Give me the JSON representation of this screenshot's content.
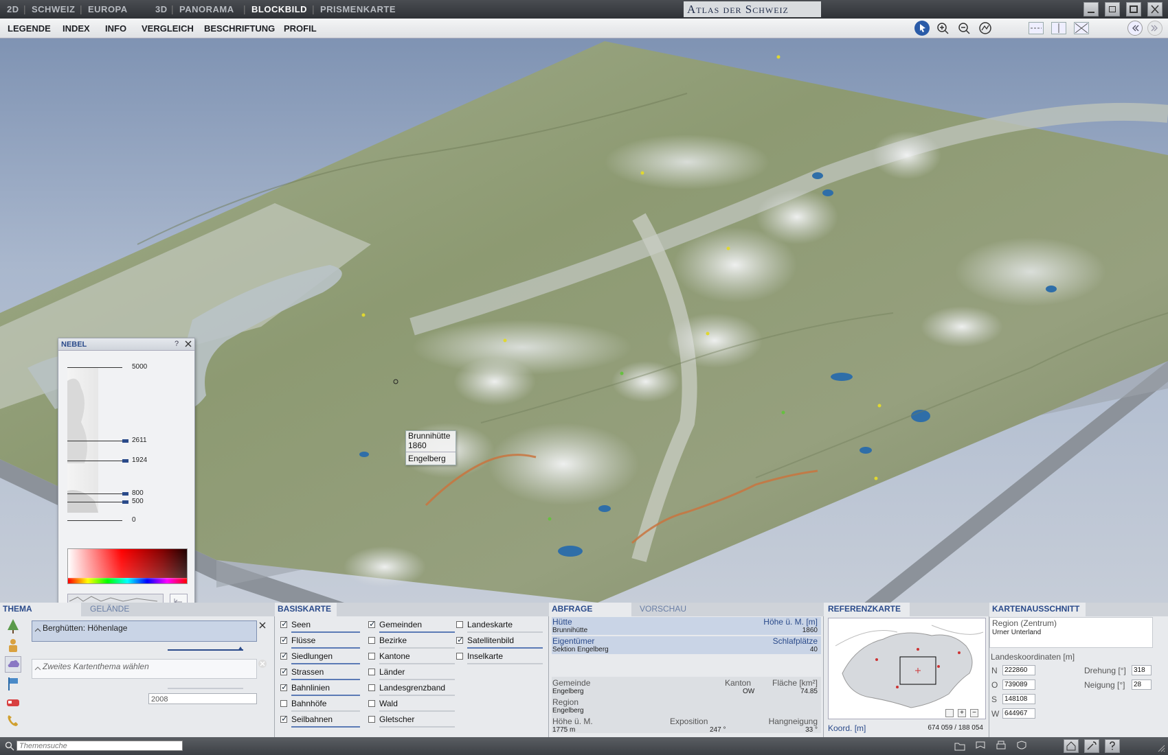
{
  "topbar": {
    "modes_2d": [
      "2D",
      "SCHWEIZ",
      "EUROPA"
    ],
    "modes_3d": [
      "3D",
      "PANORAMA",
      "BLOCKBILD",
      "PRISMENKARTE"
    ],
    "active": "BLOCKBILD",
    "app_title": "Atlas der Schweiz"
  },
  "menubar": {
    "items": [
      "LEGENDE",
      "INDEX",
      "INFO",
      "VERGLEICH",
      "BESCHRIFTUNG",
      "PROFIL"
    ]
  },
  "nebel": {
    "title": "NEBEL",
    "help": "?",
    "ticks": [
      "5000",
      "2611",
      "1924",
      "800",
      "500",
      "0"
    ]
  },
  "tooltip": {
    "name": "Brunnihütte",
    "height": "1860",
    "place": "Engelberg"
  },
  "thema": {
    "tab_active": "THEMA",
    "tab_inactive": "GELÄNDE",
    "theme1": "Berghütten: Höhenlage",
    "theme2_placeholder": "Zweites Kartenthema wählen",
    "year": "2008"
  },
  "basiskarte": {
    "title": "BASISKARTE",
    "col1": [
      {
        "label": "Seen",
        "checked": true
      },
      {
        "label": "Flüsse",
        "checked": true
      },
      {
        "label": "Siedlungen",
        "checked": true
      },
      {
        "label": "Strassen",
        "checked": true
      },
      {
        "label": "Bahnlinien",
        "checked": true
      },
      {
        "label": "Bahnhöfe",
        "checked": false
      },
      {
        "label": "Seilbahnen",
        "checked": true
      }
    ],
    "col2": [
      {
        "label": "Gemeinden",
        "checked": true
      },
      {
        "label": "Bezirke",
        "checked": false
      },
      {
        "label": "Kantone",
        "checked": false
      },
      {
        "label": "Länder",
        "checked": false
      },
      {
        "label": "Landesgrenzband",
        "checked": false
      },
      {
        "label": "Wald",
        "checked": false
      },
      {
        "label": "Gletscher",
        "checked": false
      }
    ],
    "col3": [
      {
        "label": "Landeskarte",
        "checked": false
      },
      {
        "label": "Satellitenbild",
        "checked": true
      },
      {
        "label": "Inselkarte",
        "checked": false
      }
    ]
  },
  "abfrage": {
    "tab_active": "ABFRAGE",
    "tab_inactive": "VORSCHAU",
    "huette_label": "Hütte",
    "huette_value": "Brunnihütte",
    "hoehe_label": "Höhe ü. M. [m]",
    "hoehe_value": "1860",
    "eigentuemer_label": "Eigentümer",
    "eigentuemer_value": "Sektion Engelberg",
    "schlafplaetze_label": "Schlafplätze",
    "schlafplaetze_value": "40",
    "gemeinde_label": "Gemeinde",
    "gemeinde_value": "Engelberg",
    "kanton_label": "Kanton",
    "kanton_value": "OW",
    "flaeche_label": "Fläche [km²]",
    "flaeche_value": "74.85",
    "region_label": "Region",
    "region_value": "Engelberg",
    "hoehe2_label": "Höhe ü. M.",
    "hoehe2_value": "1775 m",
    "exposition_label": "Exposition",
    "exposition_value": "247 °",
    "hangneigung_label": "Hangneigung",
    "hangneigung_value": "33 °"
  },
  "referenzkarte": {
    "title": "REFERENZKARTE",
    "koord_label": "Koord. [m]",
    "koord_value": "674 059 / 188 054"
  },
  "kartenausschnitt": {
    "title": "KARTENAUSSCHNITT",
    "region_label": "Region (Zentrum)",
    "region_value": "Urner Unterland",
    "landeskoord_label": "Landeskoordinaten [m]",
    "n_label": "N",
    "n_value": "222860",
    "o_label": "O",
    "o_value": "739089",
    "s_label": "S",
    "s_value": "148108",
    "w_label": "W",
    "w_value": "644967",
    "drehung_label": "Drehung [°]",
    "drehung_value": "318",
    "neigung_label": "Neigung [°]",
    "neigung_value": "28"
  },
  "statusbar": {
    "search_placeholder": "Themensuche"
  },
  "colors": {
    "accent": "#2a4a8a",
    "water": "#2f6ea8",
    "snow": "#eef0f2"
  }
}
